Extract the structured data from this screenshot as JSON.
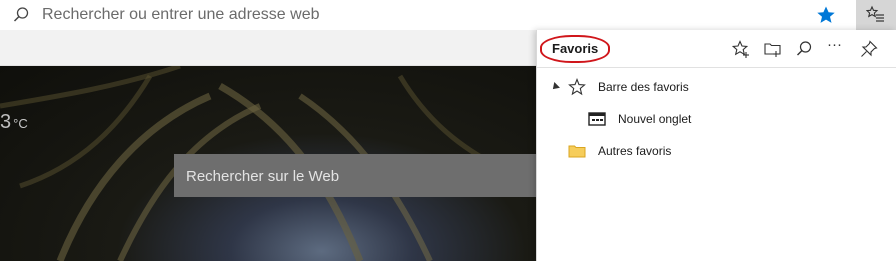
{
  "address_bar": {
    "placeholder": "Rechercher ou entrer une adresse web",
    "favorite_star_color": "#0078d7"
  },
  "new_tab_page": {
    "weather_unit": "°C",
    "weather_partial_digit": "3",
    "search_placeholder": "Rechercher sur le Web"
  },
  "favorites_pane": {
    "title": "Favoris",
    "header_buttons": [
      "add-favorite-icon",
      "add-folder-icon",
      "search-icon",
      "more-icon",
      "pin-icon"
    ],
    "more_glyph": "···",
    "items": [
      {
        "label": "Barre des favoris",
        "icon": "star-outline-icon",
        "expanded": true,
        "level": 0
      },
      {
        "label": "Nouvel onglet",
        "icon": "page-icon",
        "level": 1
      },
      {
        "label": "Autres favoris",
        "icon": "folder-icon",
        "level": 0
      }
    ],
    "annotation_color": "#d0161b"
  }
}
